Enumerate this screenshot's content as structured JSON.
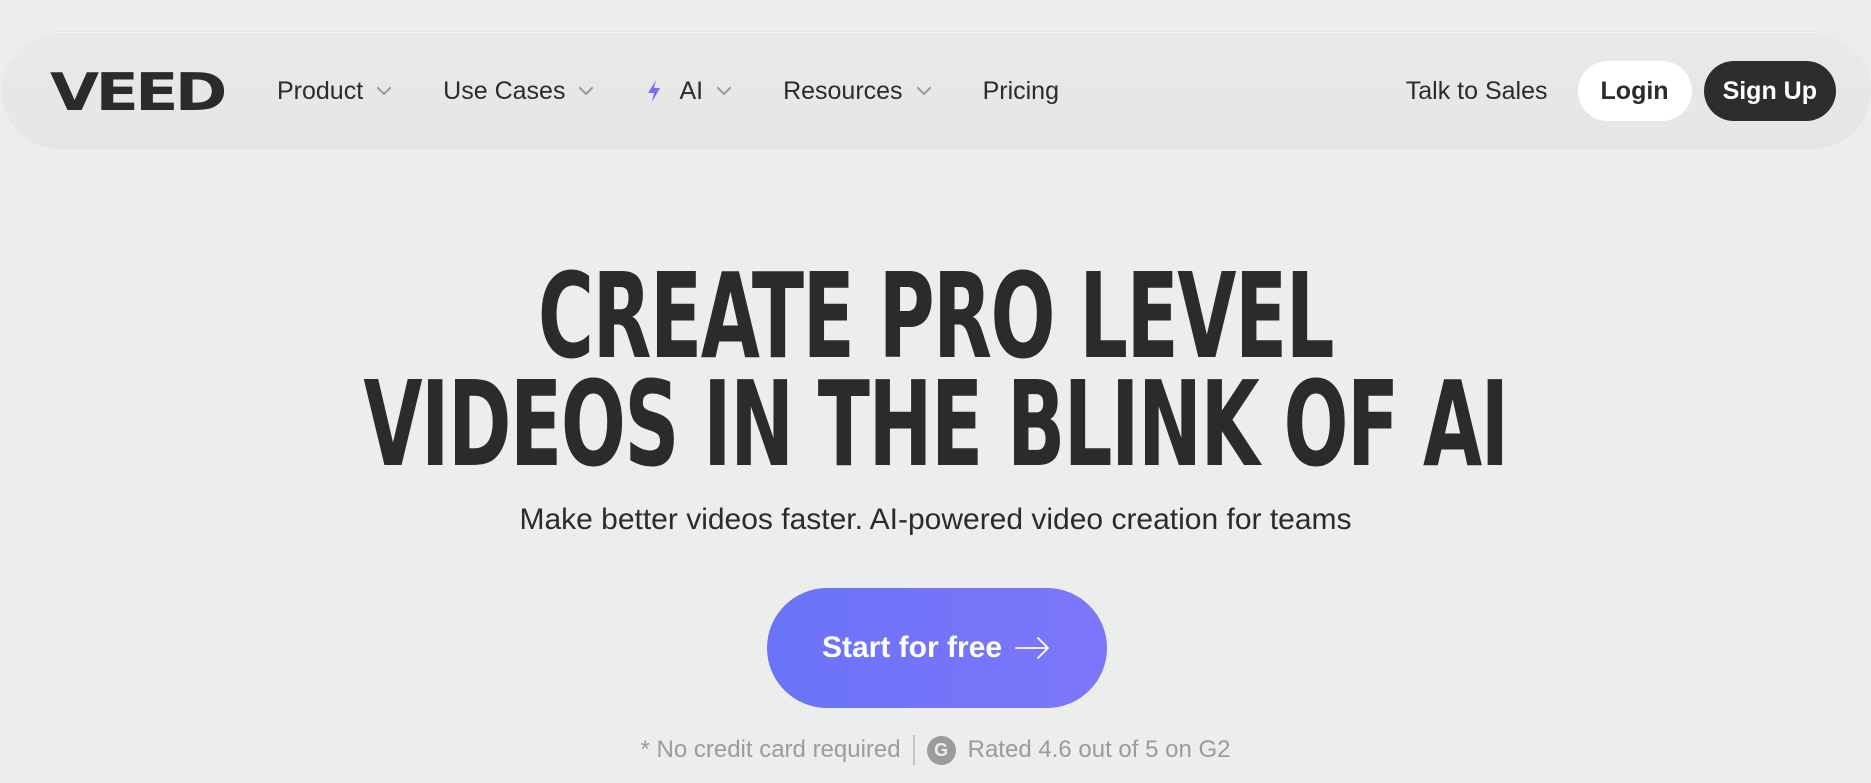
{
  "brand": {
    "logo_text": "VEED"
  },
  "nav": {
    "items": [
      {
        "label": "Product"
      },
      {
        "label": "Use Cases"
      },
      {
        "label": "AI"
      },
      {
        "label": "Resources"
      },
      {
        "label": "Pricing"
      }
    ],
    "talk_to_sales": "Talk to Sales",
    "login": "Login",
    "signup": "Sign Up"
  },
  "hero": {
    "title_line_1": "CREATE PRO LEVEL",
    "title_line_2": "VIDEOS IN THE BLINK OF AI",
    "subtitle": "Make better videos faster. AI-powered video creation for teams",
    "cta": "Start for free",
    "note": "* No credit card required",
    "rating_badge": "G",
    "rating": "Rated 4.6 out of 5 on G2"
  },
  "colors": {
    "background": "#eceeed",
    "text": "#2b2b2b",
    "cta_start": "#6a73f7",
    "cta_end": "#7d76fb",
    "ai_bolt": "#7b6cf6"
  },
  "icons": {
    "chevron": "chevron-down-icon",
    "bolt": "bolt-icon",
    "arrow": "arrow-right-icon",
    "g2": "g2-logo-icon"
  }
}
